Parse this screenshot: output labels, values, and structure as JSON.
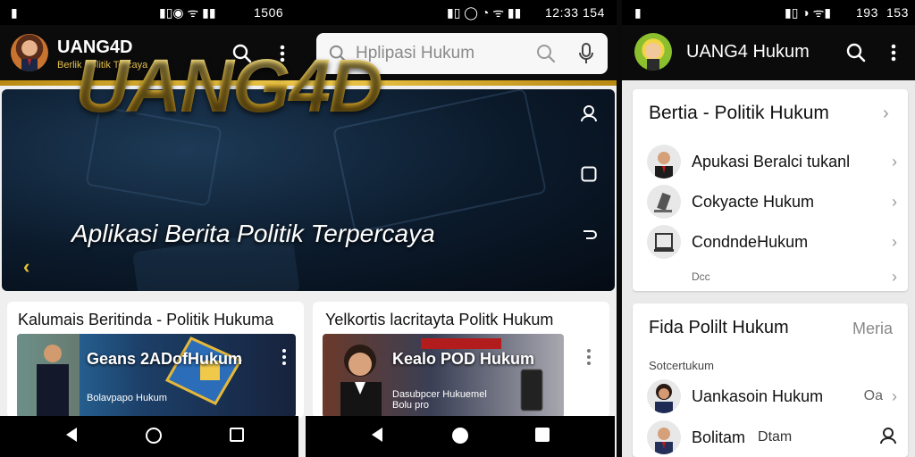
{
  "left_status": {
    "left_icons": "▮",
    "mid_icons": "▮▯◉ ᯤ ▮▮",
    "time": "1506",
    "right_icons": "▮▯ ◯ ◔ ᯤ ▮▮",
    "time2": "12:33",
    "batt": "154"
  },
  "right_status": {
    "left_icons": "▮",
    "mid_icons": "▮▯ ◑ ᯤ▮",
    "time": "193",
    "batt": "153"
  },
  "app": {
    "title": "UANG4D",
    "subtitle": "Berlik Politik Tercaya"
  },
  "search": {
    "placeholder": "Hplipasi Hukum"
  },
  "hero": {
    "title": "UANG4D",
    "subtitle": "Aplikasi Berita Politik Terpercaya"
  },
  "cards": [
    {
      "title": "Kalumais Beritinda - Politik Hukuma",
      "thumb_title": "Geans 2ADofHukum",
      "thumb_sub": "Bolavpapo Hukum"
    },
    {
      "title": "Yelkortis lacritayta Politk Hukum",
      "thumb_title": "Kealo POD Hukum",
      "thumb_sub": "Dasubpcer Hukuemel Bolu pro"
    }
  ],
  "right": {
    "title": "UANG4 Hukum",
    "panel1": {
      "heading": "Bertia - Politik Hukum",
      "items": [
        {
          "label": "Apukasi Beralci tukanl"
        },
        {
          "label": "Cokyacte Hukum"
        },
        {
          "label": "CondndeHukum"
        },
        {
          "label": "Dcc"
        }
      ]
    },
    "panel2": {
      "heading": "Fida Polilt Hukum",
      "heading_right": "Meria",
      "section": "Sotcertukum",
      "items": [
        {
          "label": "Uankasoin Hukum",
          "extra": "Oa"
        },
        {
          "label": "Bolitam",
          "extra": "Dtam"
        }
      ]
    }
  },
  "colors": {
    "gold": "#e8b930",
    "appbar": "#0b0b0b"
  }
}
